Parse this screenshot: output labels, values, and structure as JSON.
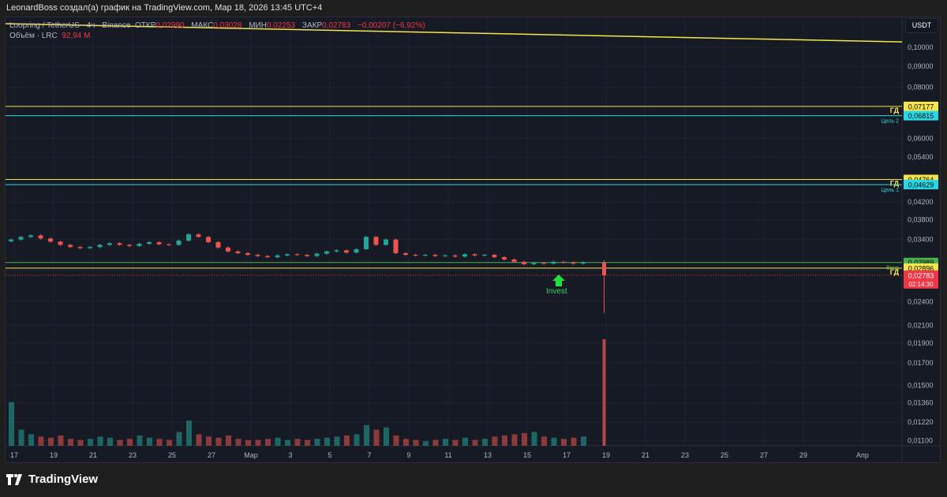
{
  "credit": "LeonardBoss создал(а) график на TradingView.com, Мар 18, 2026 13:45 UTC+4",
  "legend": {
    "symbol": "Loopring / TetherUS · 4ч · Binance",
    "open_label": "ОТКР",
    "open": "0,02990",
    "high_label": "МАКС",
    "high": "0,03028",
    "low_label": "МИН",
    "low": "0,02253",
    "close_label": "ЗАКР",
    "close": "0,02783",
    "change": "−0,00207 (−6,92%)",
    "volume_label": "Объём · LRC",
    "volume": "92,94 M"
  },
  "currency": "USDT",
  "logo": "TradingView",
  "colors": {
    "up": "#26a69a",
    "down": "#ef5350",
    "level_gd": "#f5e44a",
    "level_target": "#26d9e6",
    "level_entry": "#4caf50",
    "current": "#f23645",
    "background": "#161a25"
  },
  "chart_data": {
    "type": "candlestick",
    "title": "",
    "scale": "log",
    "ylim": [
      0.0108,
      0.118
    ],
    "grid": true,
    "y_ticks": [
      "0,10000",
      "0,09000",
      "0,08000",
      "0,06000",
      "0,05400",
      "0,04200",
      "0,03800",
      "0,03400",
      "0,02400",
      "0,02100",
      "0,01900",
      "0,01700",
      "0,01500",
      "0,01360",
      "0,01220",
      "0,01100"
    ],
    "y_tick_values": [
      0.1,
      0.09,
      0.08,
      0.06,
      0.054,
      0.042,
      0.038,
      0.034,
      0.024,
      0.021,
      0.019,
      0.017,
      0.015,
      0.0136,
      0.0122,
      0.011
    ],
    "x_ticks": [
      "17",
      "19",
      "21",
      "23",
      "25",
      "27",
      "Мар",
      "3",
      "5",
      "7",
      "9",
      "11",
      "13",
      "15",
      "17",
      "19",
      "21",
      "23",
      "25",
      "27",
      "29",
      "Апр"
    ],
    "x_tick_days": [
      0,
      2,
      4,
      6,
      8,
      10,
      12,
      14,
      16,
      18,
      20,
      22,
      24,
      26,
      28,
      30,
      32,
      34,
      36,
      38,
      40,
      43
    ],
    "closes": [
      0.034,
      0.0345,
      0.0348,
      0.0342,
      0.0336,
      0.033,
      0.0326,
      0.0324,
      0.0326,
      0.033,
      0.0333,
      0.033,
      0.0328,
      0.0332,
      0.0335,
      0.0331,
      0.033,
      0.0338,
      0.035,
      0.0345,
      0.0335,
      0.0325,
      0.0318,
      0.0315,
      0.0312,
      0.031,
      0.0308,
      0.0311,
      0.0313,
      0.0312,
      0.031,
      0.0314,
      0.0318,
      0.032,
      0.0316,
      0.0322,
      0.0345,
      0.033,
      0.034,
      0.0315,
      0.0312,
      0.0311,
      0.0312,
      0.031,
      0.0311,
      0.0309,
      0.0313,
      0.0311,
      0.0312,
      0.0308,
      0.0304,
      0.03,
      0.0296,
      0.0298,
      0.0297,
      0.03,
      0.0299,
      0.0297,
      0.0299
    ],
    "volumes_m": [
      38,
      14,
      10,
      8,
      7,
      9,
      6,
      5,
      6,
      8,
      7,
      5,
      6,
      9,
      7,
      6,
      5,
      12,
      22,
      10,
      8,
      7,
      9,
      6,
      5,
      5,
      6,
      7,
      5,
      6,
      5,
      6,
      7,
      8,
      9,
      10,
      18,
      14,
      16,
      9,
      6,
      5,
      4,
      5,
      6,
      5,
      7,
      5,
      6,
      8,
      9,
      10,
      11,
      12,
      8,
      7,
      6,
      7,
      8
    ],
    "last_candle": {
      "open": 0.0299,
      "high": 0.03028,
      "low": 0.02253,
      "close": 0.02783,
      "volume_m": 92.94
    },
    "trendline": {
      "start": 0.1142,
      "end": 0.1031
    },
    "levels": [
      {
        "price": 0.07177,
        "label": "ГД",
        "price_label": "0,07177",
        "kind": "gd"
      },
      {
        "price": 0.06815,
        "label": "Цель 2",
        "price_label": "0,06815",
        "kind": "target"
      },
      {
        "price": 0.04764,
        "label": "ГД",
        "price_label": "0,04764",
        "kind": "gd"
      },
      {
        "price": 0.04629,
        "label": "Цель 1",
        "price_label": "0,04629",
        "kind": "target"
      },
      {
        "price": 0.02989,
        "label": "Вход",
        "price_label": "0,02989",
        "kind": "entry"
      },
      {
        "price": 0.02896,
        "label": "ГД",
        "price_label": "0,02896",
        "kind": "gd"
      }
    ],
    "current": {
      "price": 0.02783,
      "price_label": "0,02783",
      "countdown": "02:14:30"
    },
    "annotation": {
      "text": "Invest",
      "icon": "arrow-up-icon",
      "day": 27.4
    }
  }
}
